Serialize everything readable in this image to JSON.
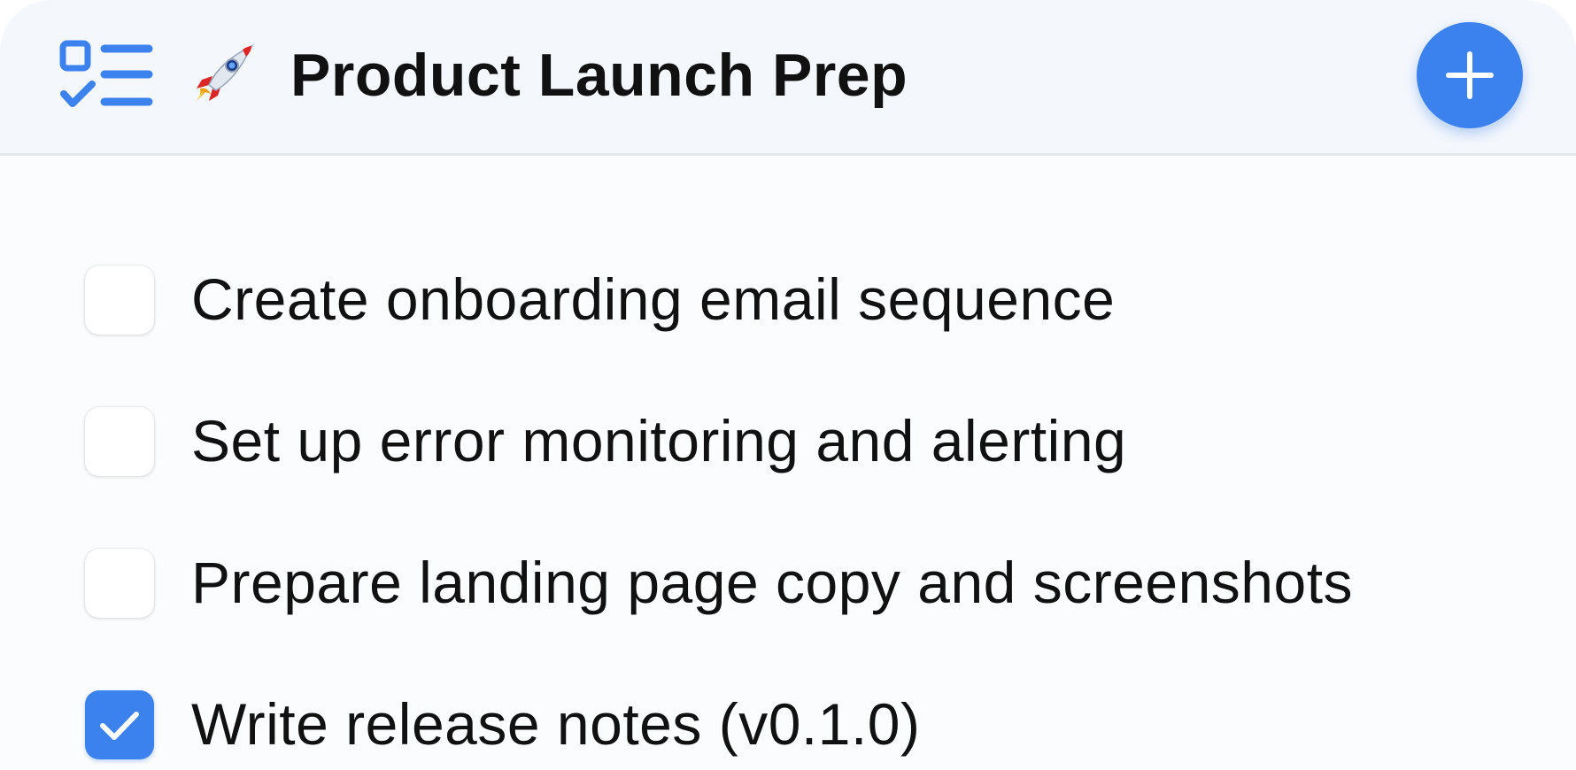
{
  "header": {
    "app_icon": "checklist-icon",
    "title_emoji_icon": "rocket-icon",
    "title": "Product Launch Prep",
    "add_button_icon": "plus-icon",
    "accent_color": "#3b82ee"
  },
  "tasks": [
    {
      "label": "Create onboarding email sequence",
      "checked": false
    },
    {
      "label": "Set up error monitoring and alerting",
      "checked": false
    },
    {
      "label": "Prepare landing page copy and screenshots",
      "checked": false
    },
    {
      "label": "Write release notes (v0.1.0)",
      "checked": true
    }
  ]
}
